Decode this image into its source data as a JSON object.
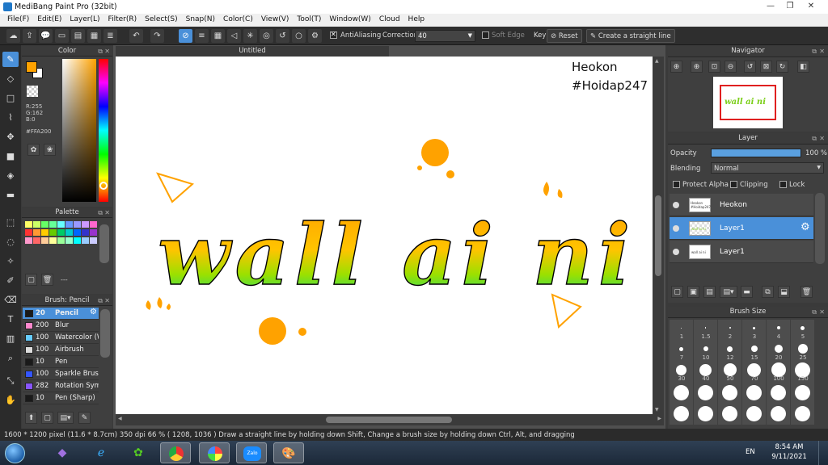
{
  "window": {
    "title": "MediBang Paint Pro (32bit)",
    "controls": [
      "—",
      "❐",
      "✕"
    ]
  },
  "menu": [
    "File(F)",
    "Edit(E)",
    "Layer(L)",
    "Filter(R)",
    "Select(S)",
    "Snap(N)",
    "Color(C)",
    "View(V)",
    "Tool(T)",
    "Window(W)",
    "Cloud",
    "Help"
  ],
  "toolbar": {
    "antialiasing_label": "AntiAliasing",
    "correction_label": "Correction",
    "correction_value": "40",
    "soft_edge_label": "Soft Edge",
    "key_label": "Key",
    "reset_label": "Reset",
    "straight_line_label": "Create a straight line"
  },
  "color_panel": {
    "title": "Color",
    "r": "R:255",
    "g": "G:162",
    "b": "B:0",
    "hex": "#FFA200",
    "foreground": "#ffa200"
  },
  "palette_panel": {
    "title": "Palette",
    "colors": [
      "#ffff66",
      "#ccff66",
      "#66ff66",
      "#66ff99",
      "#66ffff",
      "#6699ff",
      "#9999ff",
      "#cc99ff",
      "#ff66cc",
      "#ff3333",
      "#ff9933",
      "#ffcc00",
      "#66cc00",
      "#00cc66",
      "#00cccc",
      "#0066ff",
      "#3333cc",
      "#9933cc",
      "#ff99cc",
      "#ff6666",
      "#ffcc99",
      "#ffff99",
      "#99ff99",
      "#99ffcc",
      "#00ffff",
      "#99ccff",
      "#ccccff"
    ],
    "separator_text": "---"
  },
  "brush_panel": {
    "title": "Brush: Pencil",
    "items": [
      {
        "size": "20",
        "name": "Pencil",
        "swatch": "#1a1a1a"
      },
      {
        "size": "200",
        "name": "Blur",
        "swatch": "#ff88cc"
      },
      {
        "size": "100",
        "name": "Watercolor (W",
        "swatch": "#66ccff"
      },
      {
        "size": "100",
        "name": "Airbrush",
        "swatch": "#dddddd"
      },
      {
        "size": "10",
        "name": "Pen",
        "swatch": "#1a1a1a"
      },
      {
        "size": "100",
        "name": "Sparkle Brush",
        "swatch": "#3355ff"
      },
      {
        "size": "282",
        "name": "Rotation Sym",
        "swatch": "#8855ff"
      },
      {
        "size": "10",
        "name": "Pen (Sharp)",
        "swatch": "#1a1a1a"
      }
    ]
  },
  "document": {
    "tab": "Untitled",
    "watermark_line1": "Heokon",
    "watermark_line2": "#Hoidap247",
    "art_text": "wall ai ni"
  },
  "navigator_panel": {
    "title": "Navigator",
    "thumb_text": "wall ai ni"
  },
  "layer_panel": {
    "title": "Layer",
    "opacity_label": "Opacity",
    "opacity_value": "100 %",
    "opacity_fraction": 1.0,
    "blending_label": "Blending",
    "blending_value": "Normal",
    "protect_alpha_label": "Protect Alpha",
    "clipping_label": "Clipping",
    "lock_label": "Lock",
    "layers": [
      {
        "name": "Heokon",
        "thumb": "Heokon #Hoidap247"
      },
      {
        "name": "Layer1",
        "thumb": "wall ai ni"
      },
      {
        "name": "Layer1",
        "thumb": "wall ai ni"
      }
    ]
  },
  "brush_size_panel": {
    "title": "Brush Size",
    "sizes": [
      "1",
      "1.5",
      "2",
      "3",
      "4",
      "5",
      "7",
      "10",
      "12",
      "15",
      "20",
      "25",
      "30",
      "40",
      "50",
      "70",
      "100",
      "150"
    ]
  },
  "status": {
    "text": "1600 * 1200 pixel  (11.6 * 8.7cm)  350 dpi  66 %  ( 1208, 1036 )  Draw a straight line by holding down Shift, Change a brush size by holding down Ctrl, Alt, and dragging"
  },
  "taskbar": {
    "language": "EN",
    "time": "8:54 AM",
    "date": "9/11/2021",
    "zalo_label": "Zalo"
  }
}
